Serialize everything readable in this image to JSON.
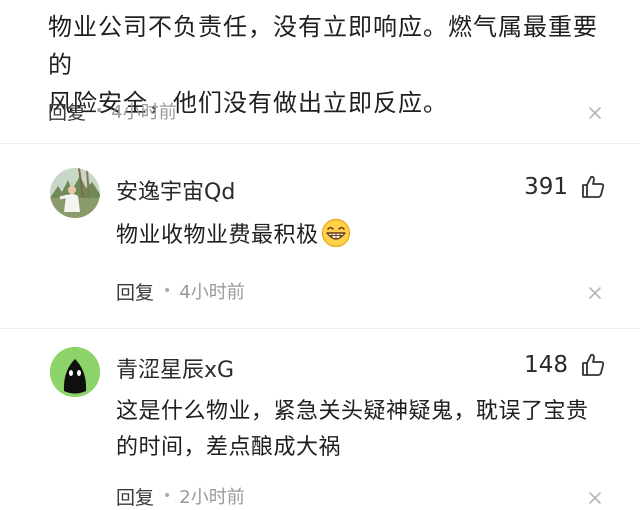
{
  "top_comment": {
    "line1": "物业公司不负责任，没有立即响应。燃气属最重要的",
    "line2": "风险安全，他们没有做出立即反应。",
    "reply_label": "回复",
    "time": "4小时前"
  },
  "comments": [
    {
      "username": "安逸宇宙Qd",
      "likes": "391",
      "text": "物业收物业费最积极",
      "emoji": "grin-emoji",
      "reply_label": "回复",
      "time": "4小时前"
    },
    {
      "username": "青涩星辰xG",
      "likes": "148",
      "text_line1": "这是什么物业，紧急关头疑神疑鬼，耽误了宝贵",
      "text_line2": "的时间，差点酿成大祸",
      "reply_label": "回复",
      "time": "2小时前"
    }
  ],
  "colors": {
    "avatar2_bg": "#8cd36a",
    "text_primary": "#1f1f1f",
    "text_muted": "#9a9a9a"
  }
}
